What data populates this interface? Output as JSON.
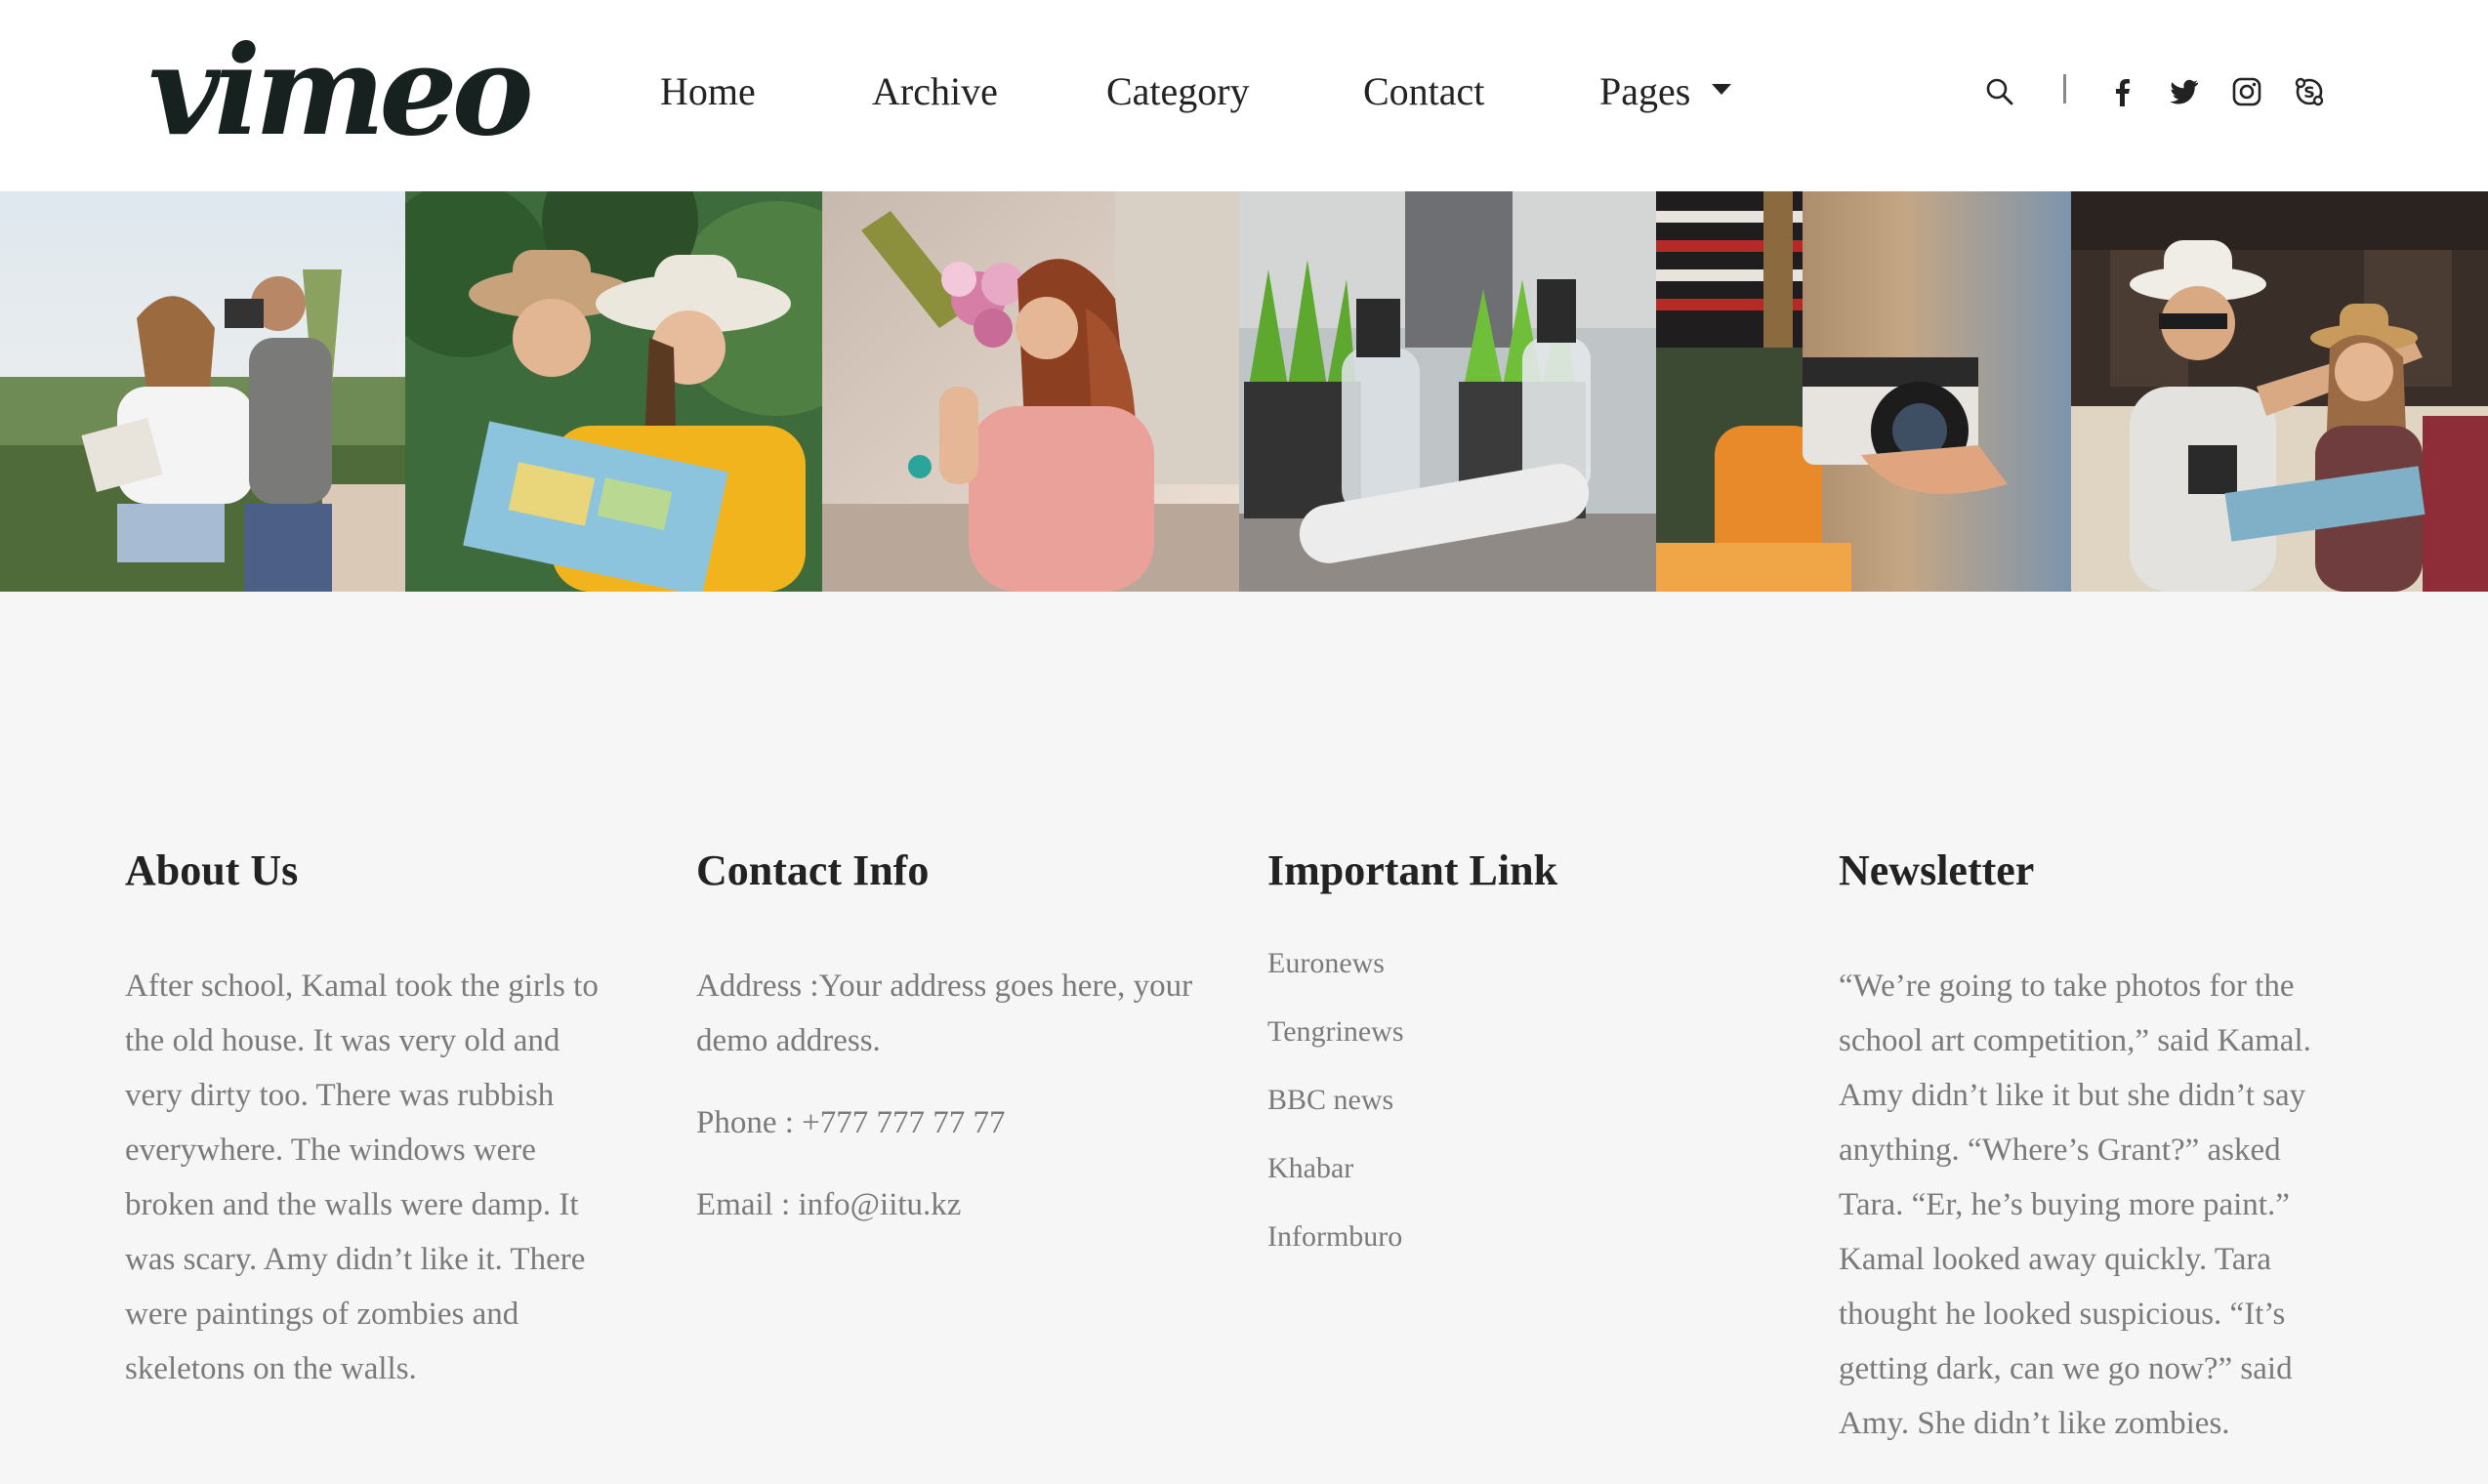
{
  "header": {
    "logo": "vimeo",
    "nav": [
      {
        "label": "Home"
      },
      {
        "label": "Archive"
      },
      {
        "label": "Category"
      },
      {
        "label": "Contact"
      },
      {
        "label": "Pages"
      }
    ],
    "social_icons": [
      "search-icon",
      "facebook-icon",
      "twitter-icon",
      "instagram-icon",
      "skype-icon"
    ]
  },
  "gallery": {
    "photos": [
      {
        "name": "couple-with-camera-and-map"
      },
      {
        "name": "two-women-reading-map"
      },
      {
        "name": "woman-with-flowers"
      },
      {
        "name": "plants-and-spray-bottles"
      },
      {
        "name": "hands-holding-camera"
      },
      {
        "name": "tourists-pointing"
      }
    ]
  },
  "footer": {
    "about": {
      "title": "About Us",
      "text": "After school, Kamal took the girls to the old house. It was very old and very dirty too. There was rubbish everywhere. The windows were broken and the walls were damp. It was scary. Amy didn’t like it. There were paintings of zombies and skeletons on the walls."
    },
    "contact": {
      "title": "Contact Info",
      "address": "Address :Your address goes here, your demo address.",
      "phone": "Phone : +777 777 77 77",
      "email": "Email : info@iitu.kz"
    },
    "links": {
      "title": "Important Link",
      "items": [
        "Euronews",
        "Tengrinews",
        "BBC news",
        "Khabar",
        "Informburo"
      ]
    },
    "newsletter": {
      "title": "Newsletter",
      "text": "“We’re going to take photos for the school art competition,” said Kamal. Amy didn’t like it but she didn’t say anything. “Where’s Grant?” asked Tara. “Er, he’s buying more paint.” Kamal looked away quickly. Tara thought he looked suspicious. “It’s getting dark, can we go now?” said Amy. She didn’t like zombies."
    }
  }
}
